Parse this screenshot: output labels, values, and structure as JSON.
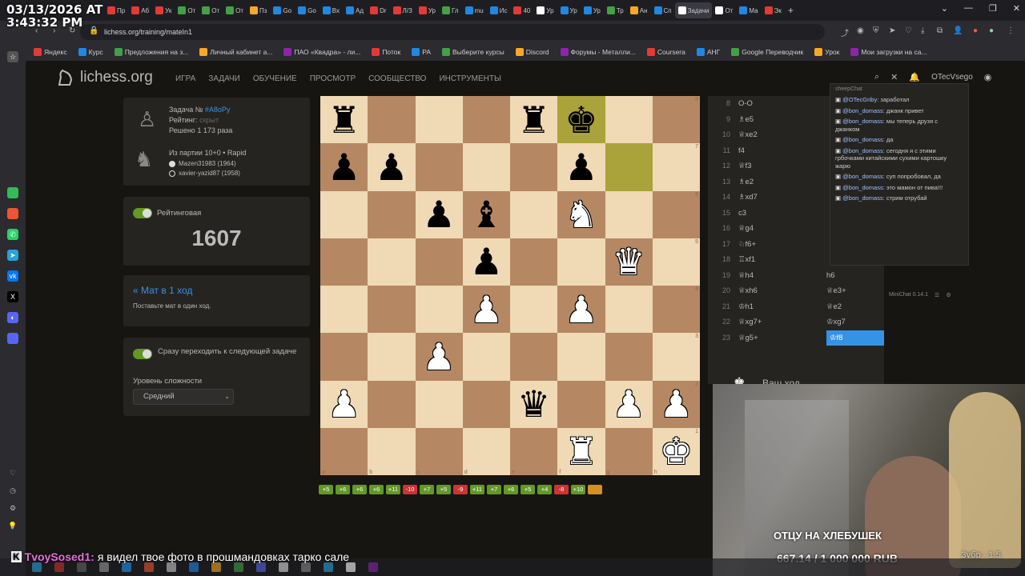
{
  "clock": {
    "date": "03/13/2026 AT",
    "time": "3:43:32 PM"
  },
  "browser": {
    "tabs": [
      {
        "label": "Пр",
        "color": "#e53935"
      },
      {
        "label": "Аб",
        "color": "#e53935"
      },
      {
        "label": "Ук",
        "color": "#e53935"
      },
      {
        "label": "От",
        "color": "#43a047"
      },
      {
        "label": "От",
        "color": "#43a047"
      },
      {
        "label": "От",
        "color": "#43a047"
      },
      {
        "label": "Пз",
        "color": "#f9a825"
      },
      {
        "label": "Go",
        "color": "#1e88e5"
      },
      {
        "label": "Go",
        "color": "#1e88e5"
      },
      {
        "label": "Вх",
        "color": "#1e88e5"
      },
      {
        "label": "Ад",
        "color": "#1e88e5"
      },
      {
        "label": "Dr",
        "color": "#e53935"
      },
      {
        "label": "Л/З",
        "color": "#e53935"
      },
      {
        "label": "Ур",
        "color": "#e53935"
      },
      {
        "label": "Гл",
        "color": "#43a047"
      },
      {
        "label": "mu",
        "color": "#1e88e5"
      },
      {
        "label": "Ис",
        "color": "#1e88e5"
      },
      {
        "label": "40",
        "color": "#e53935"
      },
      {
        "label": "Ур",
        "color": "#ffffff"
      },
      {
        "label": "Ур",
        "color": "#1e88e5"
      },
      {
        "label": "Ур",
        "color": "#1e88e5"
      },
      {
        "label": "Тр",
        "color": "#43a047"
      },
      {
        "label": "Ан",
        "color": "#f9a825"
      },
      {
        "label": "Сп",
        "color": "#1e88e5"
      },
      {
        "label": "Задачи",
        "color": "#ffffff",
        "active": true
      },
      {
        "label": "От",
        "color": "#ffffff"
      },
      {
        "label": "Ма",
        "color": "#1e88e5"
      },
      {
        "label": "Эк",
        "color": "#e53935"
      }
    ],
    "new_tab": "+",
    "url": "lichess.org/training/mateIn1",
    "bookmarks": [
      "Яндекс",
      "Курс",
      "Предложения на з...",
      "Личный кабинет а...",
      "ПАО «Квадра» - ли...",
      "Поток",
      "РА",
      "Выберите курсы",
      "Discord",
      "Форумы - Металли...",
      "Coursera",
      "АНГ",
      "Google Переводчик",
      "Урок",
      "Мои загрузки на са..."
    ]
  },
  "site": {
    "logo": "lichess.org",
    "nav": [
      "ИГРА",
      "ЗАДАЧИ",
      "ОБУЧЕНИЕ",
      "ПРОСМОТР",
      "СООБЩЕСТВО",
      "ИНСТРУМЕНТЫ"
    ],
    "username": "OTecVsego"
  },
  "puzzle": {
    "task_label": "Задача №",
    "task_id": "#A8oPy",
    "rating_label": "Рейтинг:",
    "rating_value": "скрыт",
    "solved": "Решено 1 173 раза",
    "from_game": "Из партии 10+0 • Rapid",
    "player_white": "Mazen31983 (1964)",
    "player_black": "xavier-yazid87 (1958)",
    "rated_label": "Рейтинговая",
    "rating": "1607",
    "theme_title": "« Мат в 1 ход",
    "theme_desc": "Поставьте мат в один ход.",
    "auto_next": "Сразу переходить к следующей задаче",
    "difficulty_label": "Уровень сложности",
    "difficulty_value": "Средний"
  },
  "board": {
    "rows": [
      [
        "br",
        "",
        "",
        "",
        "br",
        "bk",
        "",
        ""
      ],
      [
        "bp",
        "bp",
        "",
        "",
        "",
        "bp",
        "",
        ""
      ],
      [
        "",
        "",
        "bp",
        "bb",
        "",
        "wn",
        "",
        ""
      ],
      [
        "",
        "",
        "",
        "bp",
        "",
        "",
        "wq",
        ""
      ],
      [
        "",
        "",
        "",
        "wp",
        "",
        "wp",
        "",
        ""
      ],
      [
        "",
        "",
        "wp",
        "",
        "",
        "",
        "",
        ""
      ],
      [
        "wp",
        "",
        "",
        "",
        "bq",
        "",
        "wp",
        "wp"
      ],
      [
        "",
        "",
        "",
        "",
        "",
        "wr",
        "",
        "wk"
      ]
    ],
    "highlight": [
      [
        0,
        5
      ],
      [
        1,
        6
      ]
    ],
    "files": [
      "a",
      "b",
      "c",
      "d",
      "e",
      "f",
      "g",
      "h"
    ],
    "ranks": [
      "8",
      "7",
      "6",
      "5",
      "4",
      "3",
      "2",
      "1"
    ]
  },
  "scores": [
    {
      "v": "+5",
      "t": "good"
    },
    {
      "v": "+6",
      "t": "good"
    },
    {
      "v": "+6",
      "t": "good"
    },
    {
      "v": "+6",
      "t": "good"
    },
    {
      "v": "+11",
      "t": "good"
    },
    {
      "v": "-10",
      "t": "bad"
    },
    {
      "v": "+7",
      "t": "good"
    },
    {
      "v": "+5",
      "t": "good"
    },
    {
      "v": "-9",
      "t": "bad"
    },
    {
      "v": "+11",
      "t": "good"
    },
    {
      "v": "+7",
      "t": "good"
    },
    {
      "v": "+6",
      "t": "good"
    },
    {
      "v": "+5",
      "t": "good"
    },
    {
      "v": "+4",
      "t": "good"
    },
    {
      "v": "-8",
      "t": "bad"
    },
    {
      "v": "+10",
      "t": "good"
    },
    {
      "v": "",
      "t": "cur"
    }
  ],
  "moves": [
    {
      "n": "8",
      "w": "O-O",
      "b": ""
    },
    {
      "n": "9",
      "w": "♗e5",
      "b": ""
    },
    {
      "n": "10",
      "w": "♕xe2",
      "b": ""
    },
    {
      "n": "11",
      "w": "f4",
      "b": ""
    },
    {
      "n": "12",
      "w": "♕f3",
      "b": ""
    },
    {
      "n": "13",
      "w": "♗e2",
      "b": ""
    },
    {
      "n": "14",
      "w": "♗xd7",
      "b": ""
    },
    {
      "n": "15",
      "w": "c3",
      "b": ""
    },
    {
      "n": "16",
      "w": "♕g4",
      "b": ""
    },
    {
      "n": "17",
      "w": "♘f6+",
      "b": ""
    },
    {
      "n": "18",
      "w": "♖xf1",
      "b": ""
    },
    {
      "n": "19",
      "w": "♕h4",
      "b": "h6"
    },
    {
      "n": "20",
      "w": "♕xh6",
      "b": "♕e3+"
    },
    {
      "n": "21",
      "w": "♔h1",
      "b": "♕e2"
    },
    {
      "n": "22",
      "w": "♕xg7+",
      "b": "♔xg7"
    },
    {
      "n": "23",
      "w": "♕g5+",
      "b": "♔f8",
      "sel": true
    }
  ],
  "your_move": "Ваш ход",
  "chat": {
    "title": "sheepChat",
    "messages": [
      {
        "u": "@OTecGriby:",
        "t": "заработал"
      },
      {
        "u": "@bon_domass:",
        "t": "джанк привет"
      },
      {
        "u": "@bon_domass:",
        "t": "мы теперь друзя с джанком"
      },
      {
        "u": "@bon_domass:",
        "t": "да"
      },
      {
        "u": "@bon_domass:",
        "t": "сегодня я с этими грбочками китайскими сухими картошку жарю"
      },
      {
        "u": "@bon_domass:",
        "t": "суп попробовал, да"
      },
      {
        "u": "@bon_domass:",
        "t": "это мамон от пива!!!"
      },
      {
        "u": "@bon_domass:",
        "t": "стрим отрубай"
      }
    ],
    "minichat": "MiniChat 0.14.1"
  },
  "stream": {
    "goal_title": "ОТЦУ НА ХЛЕБУШЕК",
    "goal_amount": "667.14 / 1 000 000 RUB",
    "bottom_user": "TvoySosed1:",
    "bottom_text": "я видел твое фото в прошмандовках тарко сале",
    "badge": "Зубр - 1.5"
  }
}
